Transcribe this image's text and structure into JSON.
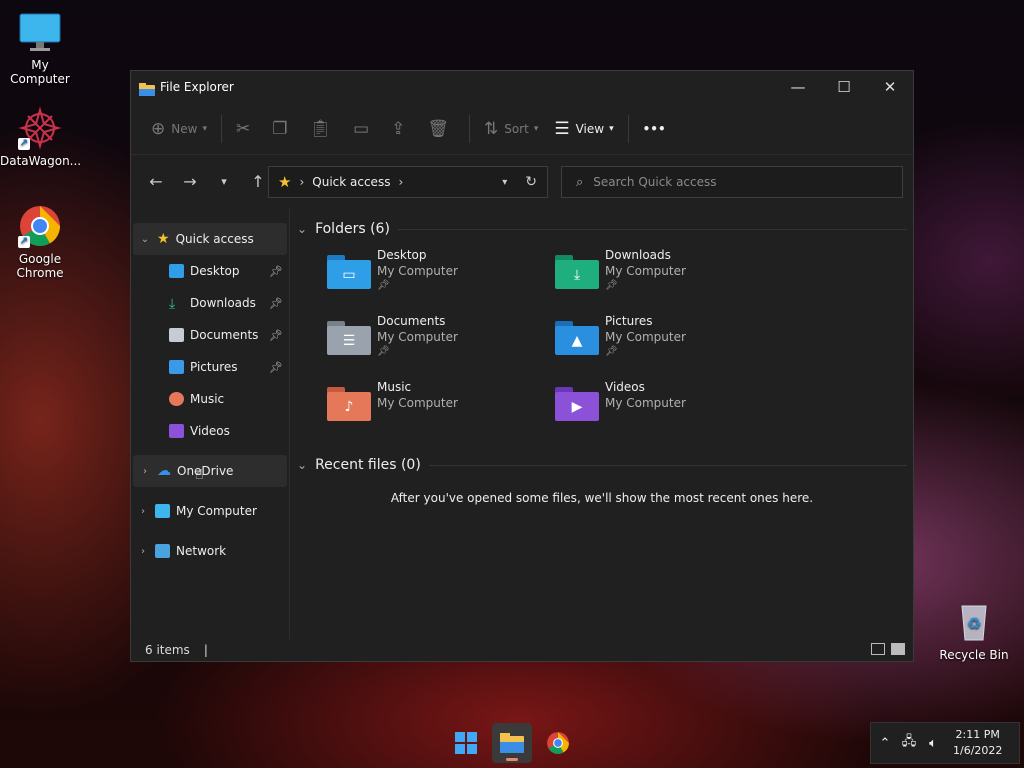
{
  "desktop": {
    "icons": [
      {
        "label": "My Computer"
      },
      {
        "label": "DataWagon..."
      },
      {
        "label": "Google Chrome"
      },
      {
        "label": "Recycle Bin"
      }
    ]
  },
  "window": {
    "title": "File Explorer",
    "controls": {
      "minimize": "—",
      "maximize": "☐",
      "close": "✕"
    },
    "commands": {
      "new": "New",
      "sort": "Sort",
      "view": "View",
      "more": "•••"
    },
    "address": {
      "location": "Quick access"
    },
    "search": {
      "placeholder": "Search Quick access"
    },
    "nav": {
      "quick_access": "Quick access",
      "items": [
        {
          "label": "Desktop",
          "pinned": true
        },
        {
          "label": "Downloads",
          "pinned": true
        },
        {
          "label": "Documents",
          "pinned": true
        },
        {
          "label": "Pictures",
          "pinned": true
        },
        {
          "label": "Music",
          "pinned": false
        },
        {
          "label": "Videos",
          "pinned": false
        }
      ],
      "onedrive": "OneDrive",
      "my_computer": "My Computer",
      "network": "Network"
    },
    "folders_header": "Folders (6)",
    "folders": [
      {
        "name": "Desktop",
        "location": "My Computer",
        "pinned": true,
        "color": "#2e9ee6"
      },
      {
        "name": "Downloads",
        "location": "My Computer",
        "pinned": true,
        "color": "#1fae7e"
      },
      {
        "name": "Documents",
        "location": "My Computer",
        "pinned": true,
        "color": "#9aa3ad"
      },
      {
        "name": "Pictures",
        "location": "My Computer",
        "pinned": true,
        "color": "#2b8fe0"
      },
      {
        "name": "Music",
        "location": "My Computer",
        "pinned": false,
        "color": "#e6785a"
      },
      {
        "name": "Videos",
        "location": "My Computer",
        "pinned": false,
        "color": "#8b52d9"
      }
    ],
    "recent_header": "Recent files (0)",
    "recent_empty": "After you've opened some files, we'll show the most recent ones here.",
    "status_count": "6 items",
    "status_cursor": "|"
  },
  "tray": {
    "time": "2:11 PM",
    "date": "1/6/2022"
  }
}
